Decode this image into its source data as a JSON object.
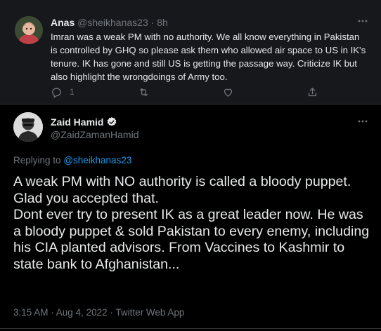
{
  "parent_tweet": {
    "name": "Anas",
    "handle": "@sheikhanas23",
    "separator": "·",
    "time": "8h",
    "text": "Imran was a weak PM with no authority. We all know everything in Pakistan is controlled by GHQ so please ask them who allowed air space to US in IK's tenure. IK has gone and still US is getting the passage way. Criticize IK but also highlight the wrongdoings of Army too.",
    "reply_count": "1",
    "icons": [
      "reply-icon",
      "retweet-icon",
      "like-icon",
      "share-icon",
      "more-icon"
    ]
  },
  "main_tweet": {
    "name": "Zaid Hamid",
    "handle": "@ZaidZamanHamid",
    "replying_prefix": "Replying to",
    "replying_to": "@sheikhanas23",
    "lines": [
      "A weak PM with NO authority is called a bloody puppet.",
      "Glad you accepted that.",
      "Dont ever try to present IK as a great leader now. He was a bloody puppet & sold Pakistan to every enemy, including his CIA planted advisors. From Vaccines to Kashmir to state bank to Afghanistan..."
    ],
    "meta": "3:15 AM · Aug 4, 2022 · Twitter Web App",
    "icons": [
      "verified-icon",
      "more-icon"
    ]
  },
  "colors": {
    "background": "#000000",
    "parent_background": "#16181c",
    "text": "#e7e9ea",
    "muted": "#71767b",
    "link": "#1d9bf0"
  }
}
